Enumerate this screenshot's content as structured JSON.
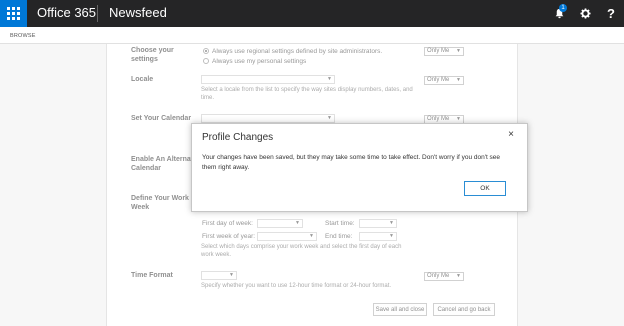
{
  "suitebar": {
    "brand": "Office 365",
    "app_title": "Newsfeed",
    "notification_count": "1",
    "icons": [
      "app-launcher-icon",
      "bell-icon",
      "gear-icon",
      "help-icon"
    ],
    "help_glyph": "?"
  },
  "ribbon": {
    "browse": "BROWSE"
  },
  "form": {
    "settings_label": "Choose your settings",
    "radio_regional": "Always use regional settings defined by site administrators.",
    "radio_personal": "Always use my personal settings",
    "privacy_value": "Only Me",
    "locale_label": "Locale",
    "locale_help": "Select a locale from the list to specify the way sites display numbers, dates, and time.",
    "calendar_label": "Set Your Calendar",
    "alt_calendar_label": "Enable An Alternate Calendar",
    "work_week_label": "Define Your Work Week",
    "first_day_label": "First day of week:",
    "start_time_label": "Start time:",
    "first_week_label": "First week of year:",
    "end_time_label": "End time:",
    "work_week_help": "Select which days comprise your work week and select the first day of each work week.",
    "time_format_label": "Time Format",
    "time_format_help": "Specify whether you want to use 12-hour time format or 24-hour format.",
    "save_button": "Save all and close",
    "cancel_button": "Cancel and go back"
  },
  "dialog": {
    "title": "Profile Changes",
    "close_glyph": "×",
    "message": "Your changes have been saved, but they may take some time to take effect. Don't worry if you don't see them right away.",
    "ok_button": "OK"
  },
  "colors": {
    "suitebar": "#252526",
    "accent": "#0078d7",
    "page_bg": "#f0f0f0"
  }
}
